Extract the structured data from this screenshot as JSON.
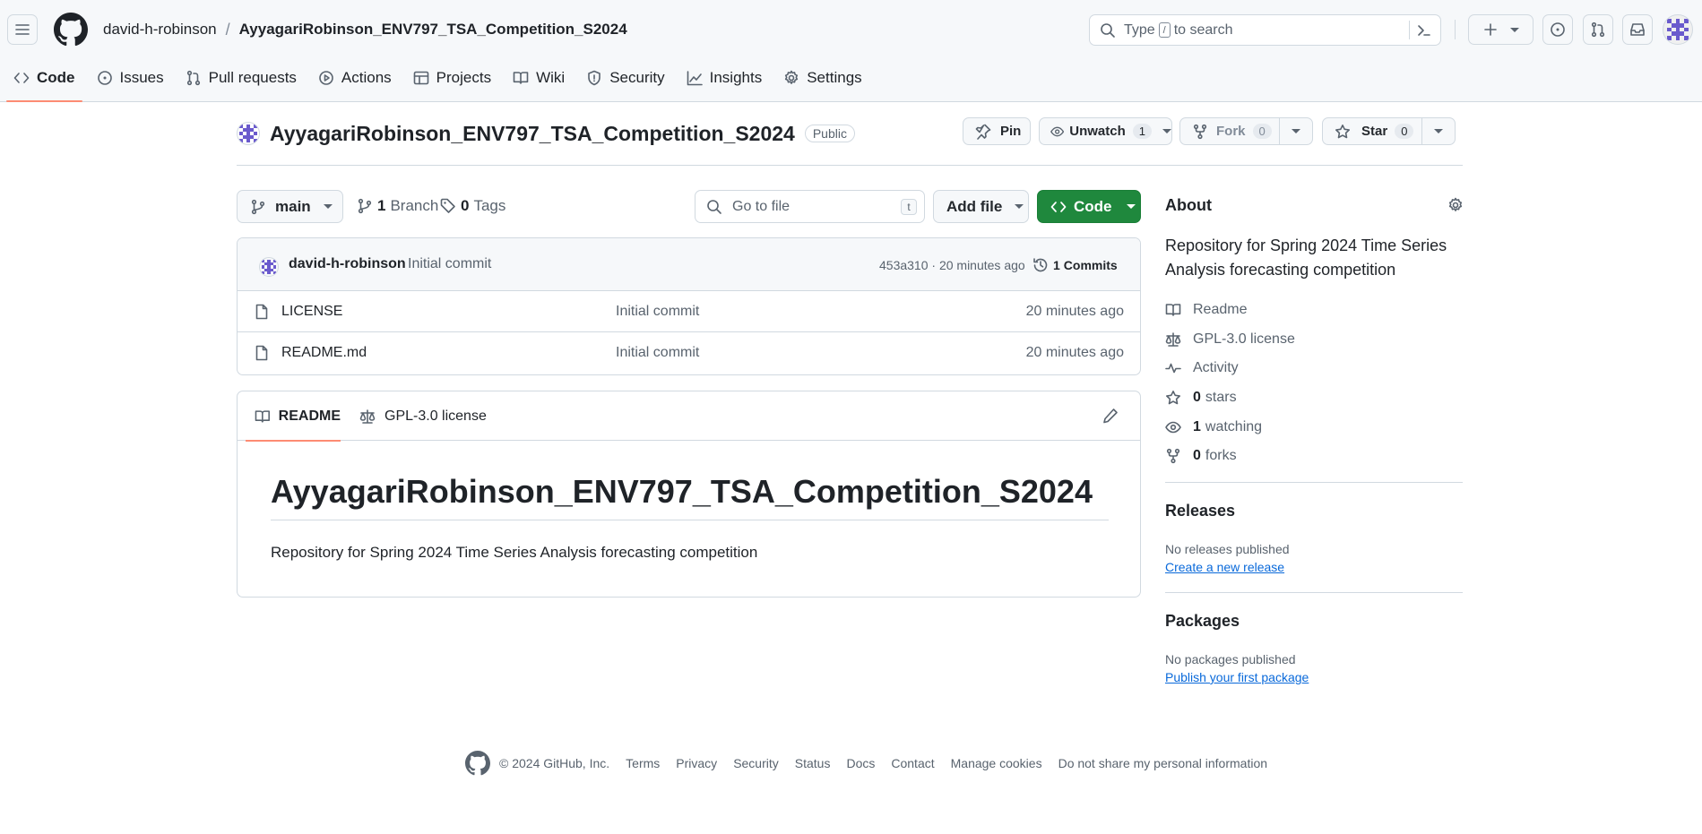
{
  "header": {
    "owner": "david-h-robinson",
    "separator": "/",
    "repo": "AyyagariRobinson_ENV797_TSA_Competition_S2024",
    "search_prefix": "Type",
    "search_key": "/",
    "search_suffix": "to search"
  },
  "tabs": [
    {
      "label": "Code",
      "icon": "code-icon"
    },
    {
      "label": "Issues",
      "icon": "issue-icon"
    },
    {
      "label": "Pull requests",
      "icon": "pull-request-icon"
    },
    {
      "label": "Actions",
      "icon": "play-icon"
    },
    {
      "label": "Projects",
      "icon": "table-icon"
    },
    {
      "label": "Wiki",
      "icon": "book-icon"
    },
    {
      "label": "Security",
      "icon": "shield-icon"
    },
    {
      "label": "Insights",
      "icon": "graph-icon"
    },
    {
      "label": "Settings",
      "icon": "gear-icon"
    }
  ],
  "repo": {
    "name": "AyyagariRobinson_ENV797_TSA_Competition_S2024",
    "visibility": "Public",
    "pin_label": "Pin",
    "watch_label": "Unwatch",
    "watch_count": "1",
    "fork_label": "Fork",
    "fork_count": "0",
    "star_label": "Star",
    "star_count": "0"
  },
  "branchbar": {
    "branch": "main",
    "branches_count": "1",
    "branches_label": "Branch",
    "tags_count": "0",
    "tags_label": "Tags",
    "goto_placeholder": "Go to file",
    "goto_key": "t",
    "add_file": "Add file",
    "code_button": "Code"
  },
  "latest_commit": {
    "author": "david-h-robinson",
    "message": "Initial commit",
    "hash_time": "453a310 · 20 minutes ago",
    "commits_count": "1",
    "commits_label": "Commits"
  },
  "files": [
    {
      "name": "LICENSE",
      "message": "Initial commit",
      "age": "20 minutes ago"
    },
    {
      "name": "README.md",
      "message": "Initial commit",
      "age": "20 minutes ago"
    }
  ],
  "readme": {
    "tab_readme": "README",
    "tab_license": "GPL-3.0 license",
    "heading": "AyyagariRobinson_ENV797_TSA_Competition_S2024",
    "body": "Repository for Spring 2024 Time Series Analysis forecasting competition"
  },
  "about": {
    "title": "About",
    "description": "Repository for Spring 2024 Time Series Analysis forecasting competition",
    "readme": "Readme",
    "license": "GPL-3.0 license",
    "activity": "Activity",
    "stars_count": "0",
    "stars_label": "stars",
    "watching_count": "1",
    "watching_label": "watching",
    "forks_count": "0",
    "forks_label": "forks"
  },
  "releases": {
    "title": "Releases",
    "empty": "No releases published",
    "link": "Create a new release"
  },
  "packages": {
    "title": "Packages",
    "empty": "No packages published",
    "link": "Publish your first package"
  },
  "footer": {
    "copyright": "© 2024 GitHub, Inc.",
    "links": [
      "Terms",
      "Privacy",
      "Security",
      "Status",
      "Docs",
      "Contact",
      "Manage cookies",
      "Do not share my personal information"
    ]
  },
  "colors": {
    "accent_green": "#1f883d",
    "link_blue": "#0969da",
    "tab_underline": "#fd8c73",
    "avatar_purple": "#6a5acd"
  }
}
